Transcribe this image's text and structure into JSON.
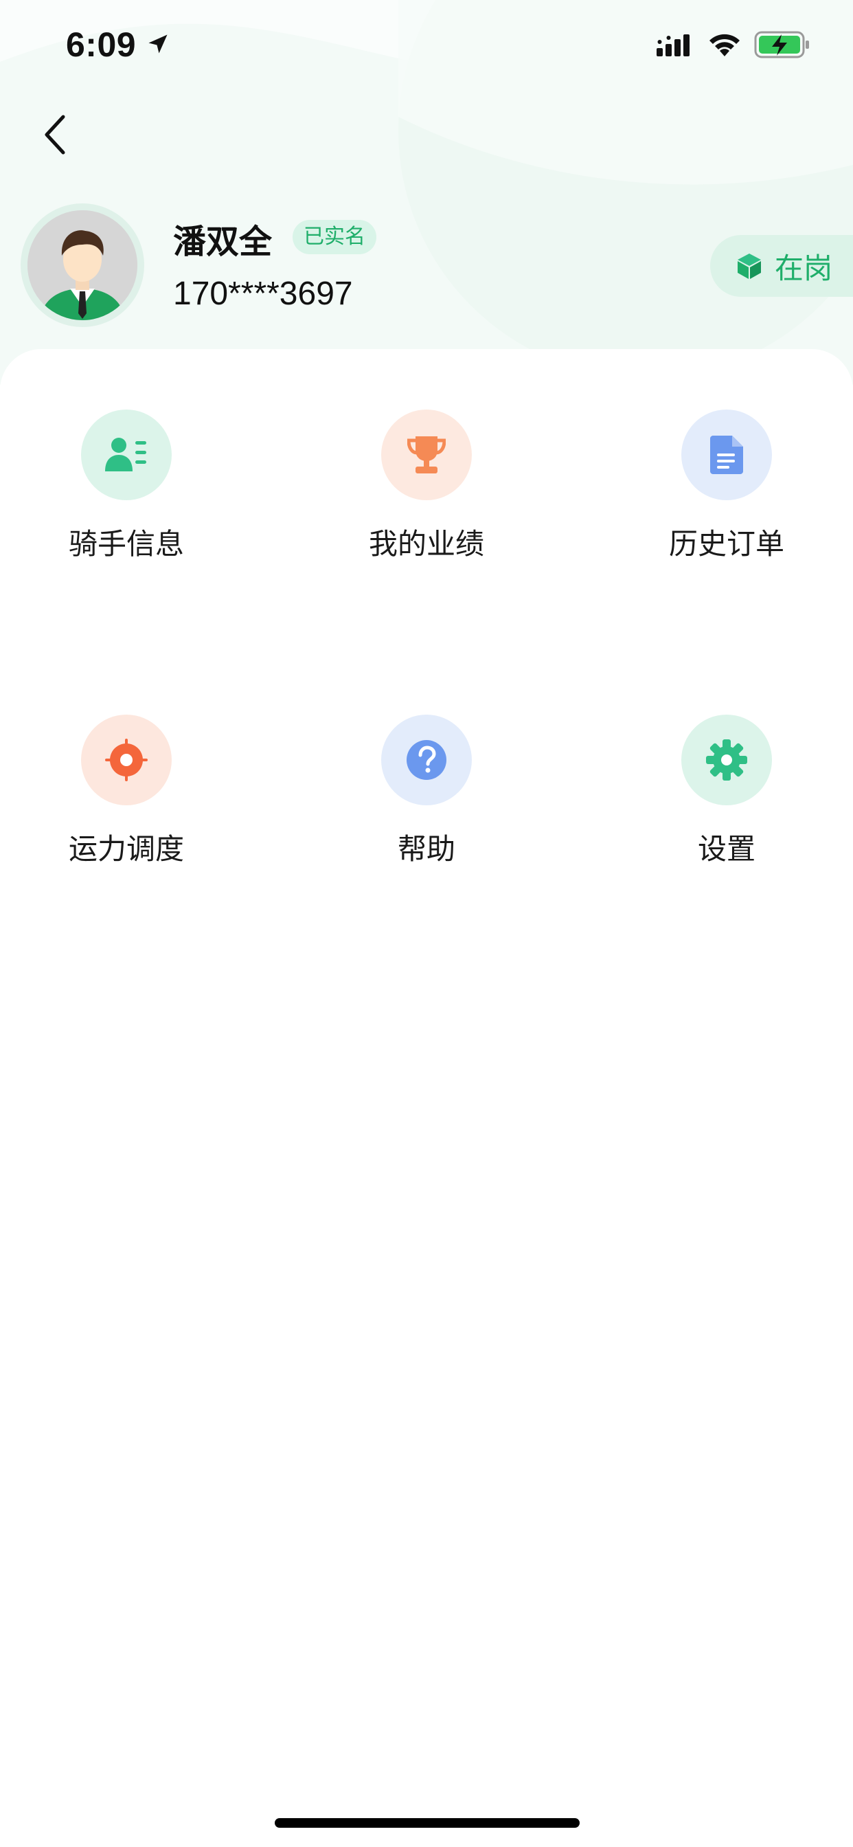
{
  "status_bar": {
    "time": "6:09",
    "icons": [
      "location-arrow-icon",
      "signal-icon",
      "wifi-icon",
      "battery-charging-icon"
    ]
  },
  "header": {
    "back_icon": "chevron-left-icon"
  },
  "profile": {
    "name": "潘双全",
    "verified_label": "已实名",
    "phone": "170****3697",
    "duty_status": "在岗",
    "duty_icon": "cube-icon"
  },
  "menu": {
    "items": [
      {
        "label": "骑手信息",
        "icon": "rider-info-icon",
        "icon_bg": "#dcf4ea",
        "icon_color": "#2fbf86"
      },
      {
        "label": "我的业绩",
        "icon": "trophy-icon",
        "icon_bg": "#fde9e0",
        "icon_color": "#f58a55"
      },
      {
        "label": "历史订单",
        "icon": "document-icon",
        "icon_bg": "#e3ecfb",
        "icon_color": "#6b98ee"
      },
      {
        "label": "运力调度",
        "icon": "target-icon",
        "icon_bg": "#fde7de",
        "icon_color": "#f4663b"
      },
      {
        "label": "帮助",
        "icon": "help-icon",
        "icon_bg": "#e3ecfb",
        "icon_color": "#6b98ee"
      },
      {
        "label": "设置",
        "icon": "gear-icon",
        "icon_bg": "#dcf4ea",
        "icon_color": "#2fbf86"
      }
    ]
  },
  "colors": {
    "accent": "#1fae6a",
    "hero_bg": "#f3faf7"
  }
}
